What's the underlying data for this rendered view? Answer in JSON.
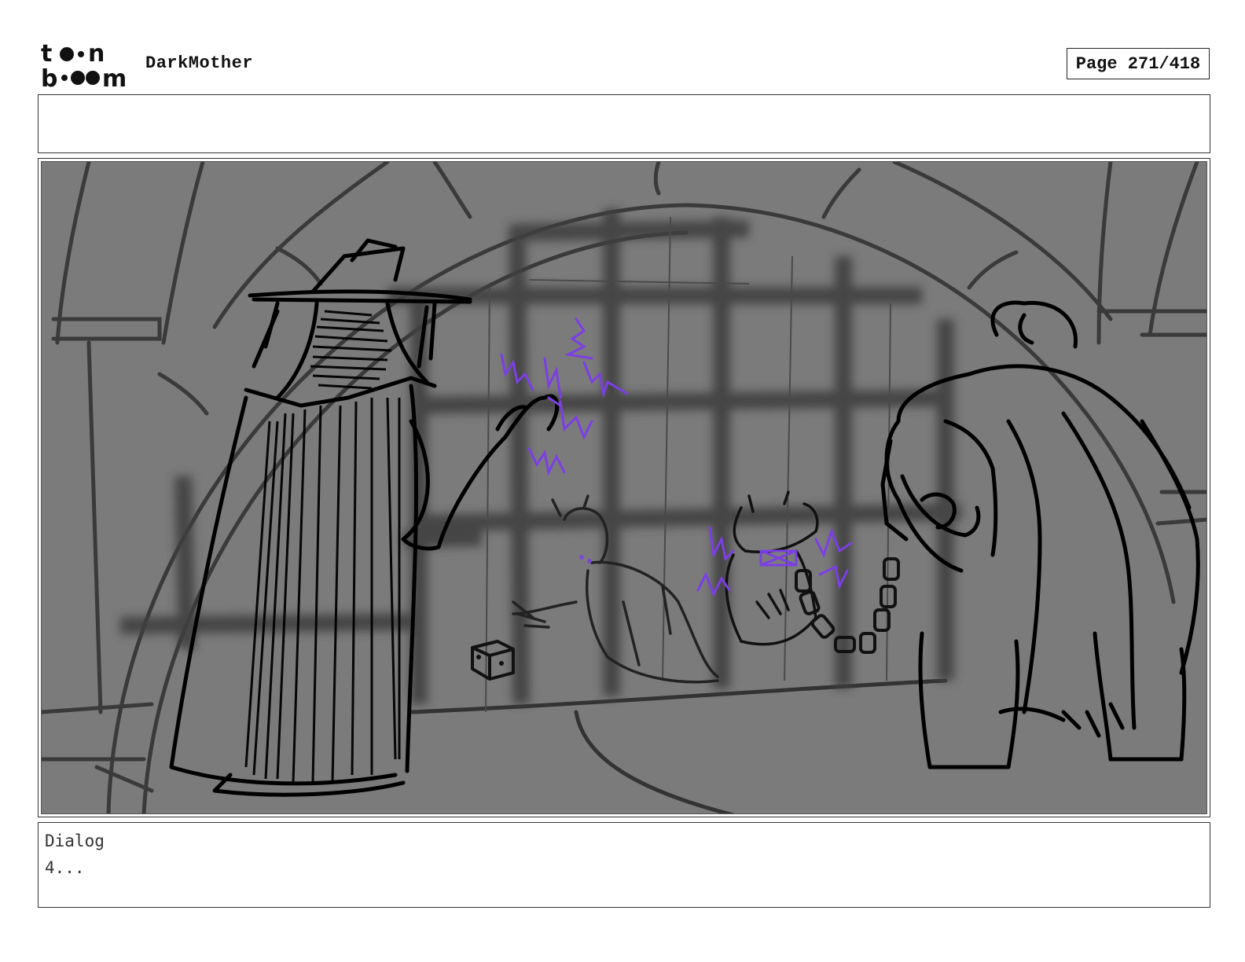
{
  "header": {
    "logo_top": "to●n",
    "logo_bottom": "b●●m",
    "project_title": "DarkMother",
    "page_label": "Page 271/418"
  },
  "notes": {
    "text": ""
  },
  "panel": {
    "background_color": "#7b7b7b",
    "magic_color": "#7b3fe4",
    "icon": "storyboard-sketch-image"
  },
  "dialog": {
    "label": "Dialog",
    "text": "4..."
  }
}
